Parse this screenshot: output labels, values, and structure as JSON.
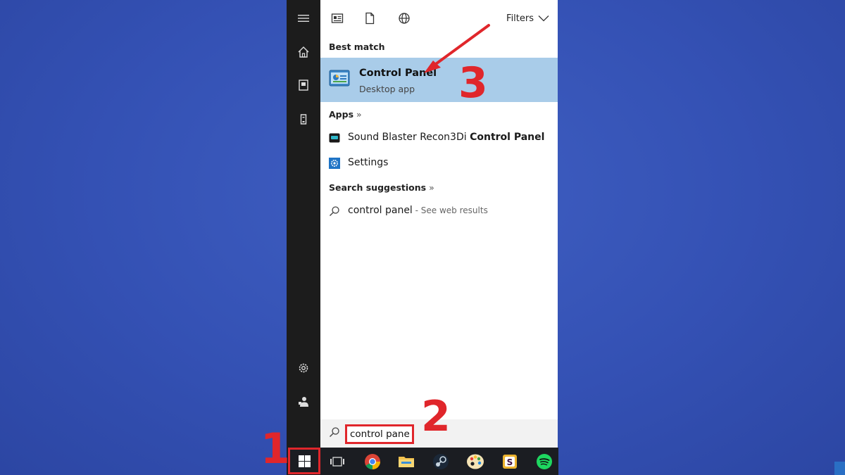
{
  "rail": {
    "icons": [
      "hamburger-menu-icon",
      "home-icon",
      "documents-icon",
      "tower-icon",
      "gear-icon",
      "user-icon"
    ]
  },
  "toolbar": {
    "filters_label": "Filters"
  },
  "best_match": {
    "heading": "Best match",
    "title": "Control Panel",
    "subtitle": "Desktop app"
  },
  "apps": {
    "heading": "Apps",
    "chevron": "»",
    "items": [
      {
        "label_prefix": "Sound Blaster Recon3Di ",
        "label_bold": "Control Panel",
        "icon": "sound-blaster-icon"
      },
      {
        "label_prefix": "Settings",
        "label_bold": "",
        "icon": "settings-icon"
      }
    ]
  },
  "suggestions": {
    "heading": "Search suggestions",
    "chevron": "»",
    "items": [
      {
        "query": "control panel",
        "hint": " - See web results"
      }
    ]
  },
  "search": {
    "value": "control panel"
  },
  "annotations": {
    "step1": "1",
    "step2": "2",
    "step3": "3"
  },
  "taskbar": {
    "items": [
      "windows-start-icon",
      "task-view-icon",
      "chrome-icon",
      "file-explorer-icon",
      "steam-icon",
      "paint-icon",
      "slack-icon",
      "spotify-icon"
    ]
  },
  "colors": {
    "annotation_red": "#e0262b",
    "highlight_blue": "#a9cce9",
    "rail_dark": "#1c1c1c",
    "desktop_blue": "#3451b4"
  }
}
